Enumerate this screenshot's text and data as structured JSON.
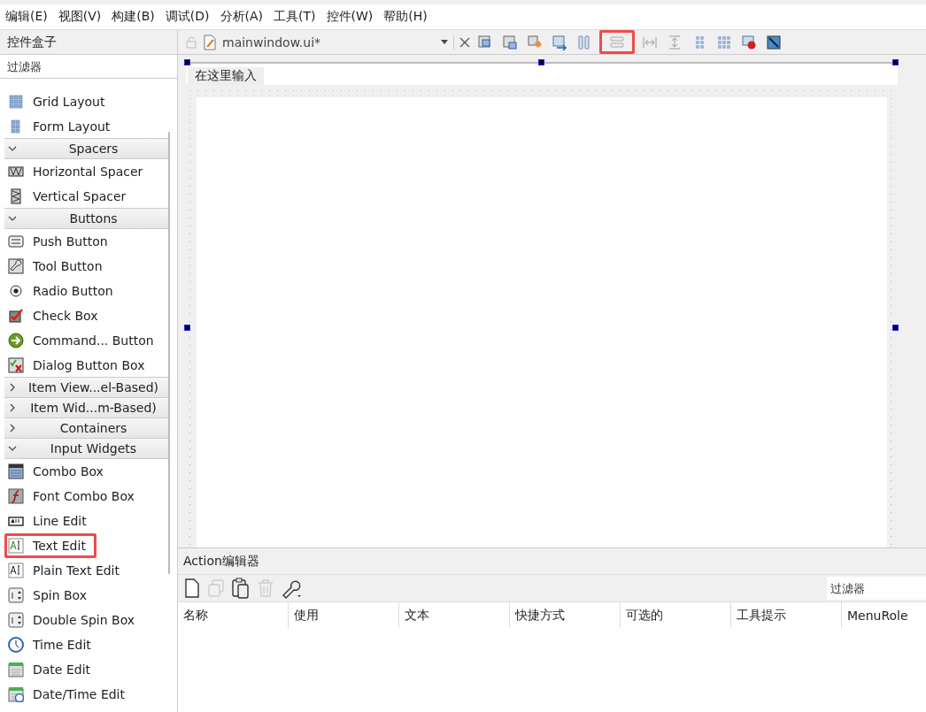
{
  "menu_bar": [
    {
      "label": "编辑(E)"
    },
    {
      "label": "视图(V)"
    },
    {
      "label": "构建(B)"
    },
    {
      "label": "调试(D)"
    },
    {
      "label": "分析(A)"
    },
    {
      "label": "工具(T)"
    },
    {
      "label": "控件(W)"
    },
    {
      "label": "帮助(H)"
    }
  ],
  "widget_box": {
    "title": "控件盒子",
    "filter_placeholder": "过滤器",
    "sections": [
      {
        "items": [
          {
            "label": "Grid Layout",
            "highlighted": false
          },
          {
            "label": "Form Layout",
            "highlighted": false
          }
        ]
      },
      {
        "title": "Spacers",
        "expanded": true,
        "items": [
          {
            "label": "Horizontal Spacer",
            "highlighted": false
          },
          {
            "label": "Vertical Spacer",
            "highlighted": false
          }
        ]
      },
      {
        "title": "Buttons",
        "expanded": true,
        "items": [
          {
            "label": "Push Button",
            "highlighted": false
          },
          {
            "label": "Tool Button",
            "highlighted": false
          },
          {
            "label": "Radio Button",
            "highlighted": false
          },
          {
            "label": "Check Box",
            "highlighted": false
          },
          {
            "label": "Command... Button",
            "highlighted": false
          },
          {
            "label": "Dialog Button Box",
            "highlighted": false
          }
        ]
      },
      {
        "title": "Item View...el-Based)",
        "expanded": false
      },
      {
        "title": "Item Wid...m-Based)",
        "expanded": false
      },
      {
        "title": "Containers",
        "expanded": false
      },
      {
        "title": "Input Widgets",
        "expanded": true,
        "items": [
          {
            "label": "Combo Box",
            "highlighted": false
          },
          {
            "label": "Font Combo Box",
            "highlighted": false
          },
          {
            "label": "Line Edit",
            "highlighted": false
          },
          {
            "label": "Text Edit",
            "highlighted": true
          },
          {
            "label": "Plain Text Edit",
            "highlighted": false
          },
          {
            "label": "Spin Box",
            "highlighted": false
          },
          {
            "label": "Double Spin Box",
            "highlighted": false
          },
          {
            "label": "Time Edit",
            "highlighted": false
          },
          {
            "label": "Date Edit",
            "highlighted": false
          },
          {
            "label": "Date/Time Edit",
            "highlighted": false
          }
        ]
      }
    ]
  },
  "editor_toolbar": {
    "file": "mainwindow.ui*",
    "tools": [
      {
        "highlighted": false
      },
      {
        "highlighted": false
      },
      {
        "highlighted": false
      },
      {
        "highlighted": false
      },
      {
        "highlighted": false
      },
      {
        "highlighted": true
      },
      {
        "highlighted": false
      },
      {
        "highlighted": false
      },
      {
        "highlighted": false
      },
      {
        "highlighted": false
      },
      {
        "highlighted": false
      },
      {
        "highlighted": false
      }
    ]
  },
  "form": {
    "menu_placeholder": "在这里输入"
  },
  "action_editor": {
    "title": "Action编辑器",
    "filter_placeholder": "过滤器",
    "columns": [
      "名称",
      "使用",
      "文本",
      "快捷方式",
      "可选的",
      "工具提示",
      "MenuRole"
    ]
  }
}
